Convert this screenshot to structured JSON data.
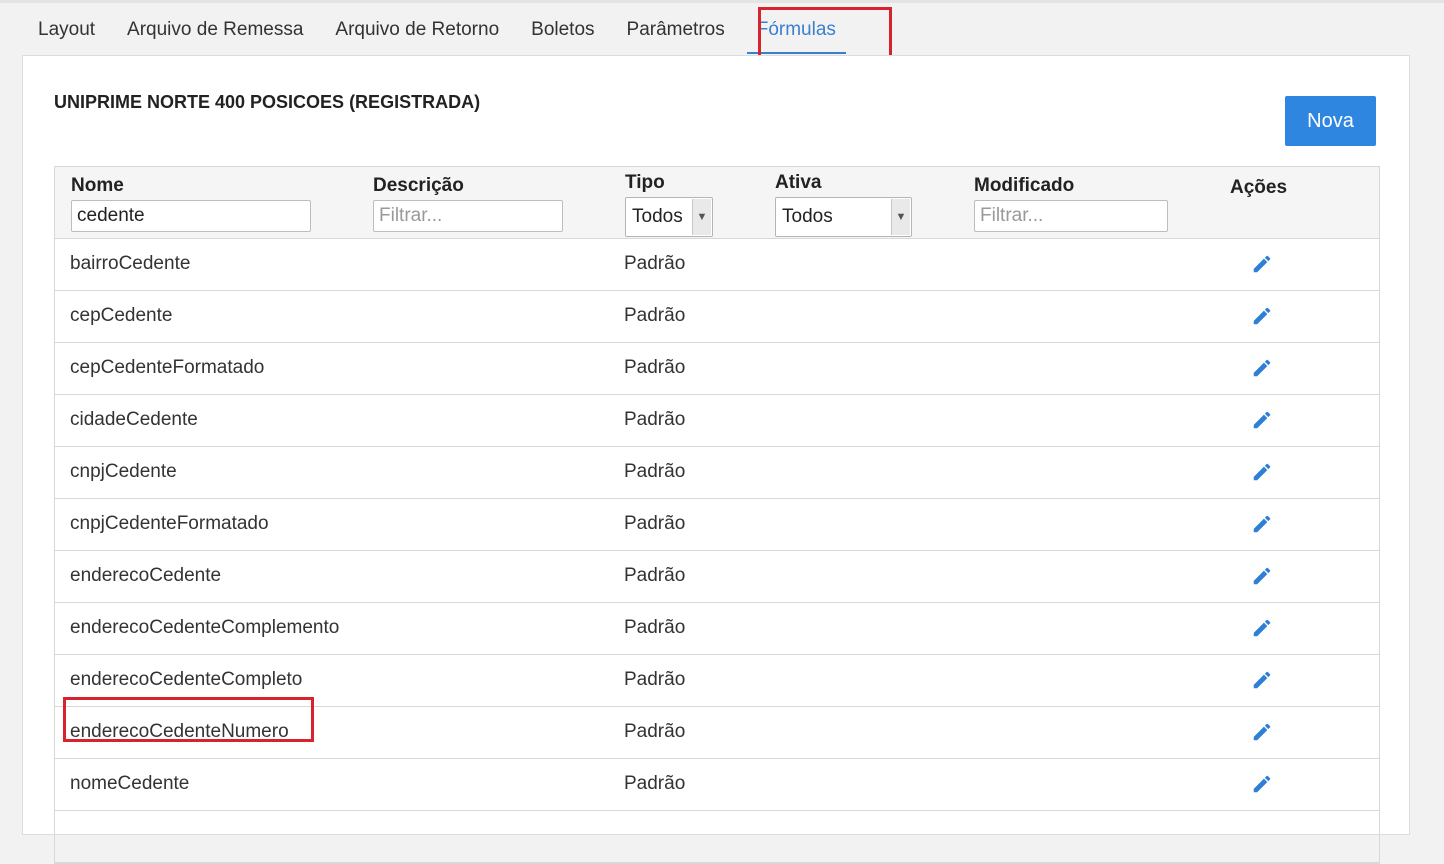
{
  "tabs": [
    {
      "label": "Layout",
      "active": false
    },
    {
      "label": "Arquivo de Remessa",
      "active": false
    },
    {
      "label": "Arquivo de Retorno",
      "active": false
    },
    {
      "label": "Boletos",
      "active": false
    },
    {
      "label": "Parâmetros",
      "active": false
    },
    {
      "label": "Fórmulas",
      "active": true
    }
  ],
  "panel": {
    "title": "UNIPRIME NORTE 400 POSICOES (REGISTRADA)",
    "new_button": "Nova"
  },
  "grid": {
    "columns": {
      "nome": "Nome",
      "descricao": "Descrição",
      "tipo": "Tipo",
      "ativa": "Ativa",
      "modificado": "Modificado",
      "acoes": "Ações"
    },
    "filters": {
      "nome_value": "cedente",
      "descricao_placeholder": "Filtrar...",
      "tipo_selected": "Todos",
      "ativa_selected": "Todos",
      "modificado_placeholder": "Filtrar..."
    },
    "rows": [
      {
        "nome": "bairroCedente",
        "tipo": "Padrão"
      },
      {
        "nome": "cepCedente",
        "tipo": "Padrão"
      },
      {
        "nome": "cepCedenteFormatado",
        "tipo": "Padrão"
      },
      {
        "nome": "cidadeCedente",
        "tipo": "Padrão"
      },
      {
        "nome": "cnpjCedente",
        "tipo": "Padrão"
      },
      {
        "nome": "cnpjCedenteFormatado",
        "tipo": "Padrão"
      },
      {
        "nome": "enderecoCedente",
        "tipo": "Padrão"
      },
      {
        "nome": "enderecoCedenteComplemento",
        "tipo": "Padrão"
      },
      {
        "nome": "enderecoCedenteCompleto",
        "tipo": "Padrão"
      },
      {
        "nome": "enderecoCedenteNumero",
        "tipo": "Padrão"
      },
      {
        "nome": "nomeCedente",
        "tipo": "Padrão"
      }
    ],
    "action_icon": "pencil-icon"
  },
  "colors": {
    "accent": "#3a7fd0",
    "button": "#2f86e0",
    "highlight": "#d7232f"
  }
}
